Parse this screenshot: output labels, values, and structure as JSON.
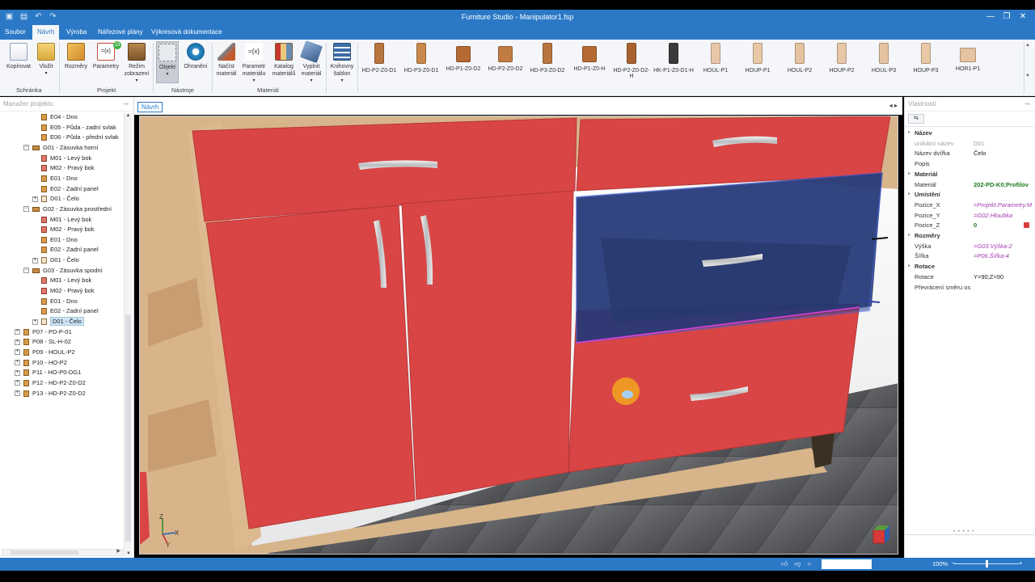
{
  "window": {
    "title": "Furniture Studio - Manipulator1.fsp"
  },
  "menu": {
    "tabs": [
      "Soubor",
      "Návrh",
      "Výroba",
      "Nářezové plány",
      "Výkresová dokumentace"
    ],
    "active": "Návrh"
  },
  "ribbon": {
    "buttons": {
      "kopirovat": "Kopírovat",
      "vlozit": "Vložit",
      "rozmery": "Rozměry",
      "parametry": "Parametry",
      "parametry_badge": "23",
      "rezim1": "Režim",
      "rezim2": "zobrazení",
      "objekt": "Objekt",
      "ohraneni": "Ohranění",
      "nacist1": "Načíst",
      "nacist2": "materiál",
      "parammat1": "Parametr",
      "parammat2": "materiálu",
      "katalog1": "Katalog",
      "katalog2": "materiálů",
      "vyplnit1": "Vyplnit",
      "vyplnit2": "materiál",
      "knihovny1": "Knihovny",
      "knihovny2": "šablon"
    },
    "groups": {
      "schranka": "Schránka",
      "projekt": "Projekt",
      "nastroje": "Nástroje",
      "material": "Materiál"
    },
    "parts": [
      "HD-P2-Z0-D1",
      "HD-P3-Z0-D1",
      "HD-P1-Z0-D2",
      "HD-P2-Z0-D2",
      "HD-P3-Z0-D2",
      "HD-P1-Z0-H",
      "HD-P2-Z0-D2-H",
      "HK-P1-Z0-D1-H",
      "HOUL-P1",
      "HOUP-P1",
      "HOUL-P2",
      "HOUP-P2",
      "HOUL-P3",
      "HOUP-P3",
      "HOR1-P1"
    ]
  },
  "project_manager": {
    "title": "Manažer projektu",
    "rows": [
      {
        "label": "E04 - Dno",
        "indent": 2,
        "icon": "board",
        "expander": ""
      },
      {
        "label": "E05 - Půda - zadní svlak",
        "indent": 2,
        "icon": "board",
        "expander": ""
      },
      {
        "label": "E06 - Půda - přední svlak",
        "indent": 2,
        "icon": "board",
        "expander": ""
      },
      {
        "label": "G01 - Zásuvka horní",
        "indent": 1,
        "icon": "drawer",
        "expander": "−"
      },
      {
        "label": "M01 - Levý bok",
        "indent": 2,
        "icon": "multi",
        "expander": ""
      },
      {
        "label": "M02 - Pravý bok",
        "indent": 2,
        "icon": "multi",
        "expander": ""
      },
      {
        "label": "E01 - Dno",
        "indent": 2,
        "icon": "board",
        "expander": ""
      },
      {
        "label": "E02 - Zadní panel",
        "indent": 2,
        "icon": "board",
        "expander": ""
      },
      {
        "label": "D01 - Čelo",
        "indent": 2,
        "icon": "front",
        "expander": "+"
      },
      {
        "label": "G02 - Zásuvka prostřední",
        "indent": 1,
        "icon": "drawer",
        "expander": "−"
      },
      {
        "label": "M01 - Levý bok",
        "indent": 2,
        "icon": "multi",
        "expander": ""
      },
      {
        "label": "M02 - Pravý bok",
        "indent": 2,
        "icon": "multi",
        "expander": ""
      },
      {
        "label": "E01 - Dno",
        "indent": 2,
        "icon": "board",
        "expander": ""
      },
      {
        "label": "E02 - Zadní panel",
        "indent": 2,
        "icon": "board",
        "expander": ""
      },
      {
        "label": "D01 - Čelo",
        "indent": 2,
        "icon": "front",
        "expander": "+"
      },
      {
        "label": "G03 - Zásuvka spodní",
        "indent": 1,
        "icon": "drawer",
        "expander": "−"
      },
      {
        "label": "M01 - Levý bok",
        "indent": 2,
        "icon": "multi",
        "expander": ""
      },
      {
        "label": "M02 - Pravý bok",
        "indent": 2,
        "icon": "multi",
        "expander": ""
      },
      {
        "label": "E01 - Dno",
        "indent": 2,
        "icon": "board",
        "expander": ""
      },
      {
        "label": "E02 - Zadní panel",
        "indent": 2,
        "icon": "board",
        "expander": ""
      },
      {
        "label": "D01 - Čelo",
        "indent": 2,
        "icon": "front",
        "expander": "+",
        "selected": true
      },
      {
        "label": "P07 - PD-P-01",
        "indent": 0,
        "icon": "board",
        "expander": "+"
      },
      {
        "label": "P08 - SL-H-02",
        "indent": 0,
        "icon": "board",
        "expander": "+"
      },
      {
        "label": "P09 - HOUL-P2",
        "indent": 0,
        "icon": "board",
        "expander": "+"
      },
      {
        "label": "P10 - HO-P2",
        "indent": 0,
        "icon": "board",
        "expander": "+"
      },
      {
        "label": "P11 - HO-P0-DG1",
        "indent": 0,
        "icon": "board",
        "expander": "+"
      },
      {
        "label": "P12 - HD-P2-Z0-D2",
        "indent": 0,
        "icon": "board",
        "expander": "+"
      },
      {
        "label": "P13 - HD-P2-Z0-D2",
        "indent": 0,
        "icon": "board",
        "expander": "+"
      }
    ]
  },
  "document_tab": "Návrh",
  "properties": {
    "title": "Vlastnosti",
    "rows": [
      {
        "key": "Název",
        "value": "",
        "type": "cat"
      },
      {
        "key": "unikátní název",
        "value": "D01",
        "type": "grey"
      },
      {
        "key": "Název dvířka",
        "value": "Čelo",
        "type": "plain"
      },
      {
        "key": "Popis",
        "value": "",
        "type": "plain"
      },
      {
        "key": "Materiál",
        "value": "",
        "type": "cat"
      },
      {
        "key": "Materiál",
        "value": "202-PD-K0;Profilov",
        "type": "green"
      },
      {
        "key": "Umístění",
        "value": "",
        "type": "cat"
      },
      {
        "key": "Pozice_X",
        "value": "=Projekt.Parametry.M",
        "type": "formula"
      },
      {
        "key": "Pozice_Y",
        "value": "=G02.Hloubka",
        "type": "formula"
      },
      {
        "key": "Pozice_Z",
        "value": "0",
        "type": "green"
      },
      {
        "key": "Rozměry",
        "value": "",
        "type": "cat"
      },
      {
        "key": "Výška",
        "value": "=G03.Výška-2",
        "type": "formula"
      },
      {
        "key": "Šířka",
        "value": "=P06.Šířka-4",
        "type": "formula"
      },
      {
        "key": "Rotace",
        "value": "",
        "type": "cat"
      },
      {
        "key": "Rotace",
        "value": "Y=90;Z=90",
        "type": "plain"
      },
      {
        "key": "Převrácení směru os",
        "value": "",
        "type": "plain"
      }
    ]
  },
  "status": {
    "zoom": "100%"
  },
  "colors": {
    "accent": "#2b79c6",
    "cabinet_red": "#d94545",
    "wood": "#d7b48a",
    "selection": "#2a3f8a"
  }
}
